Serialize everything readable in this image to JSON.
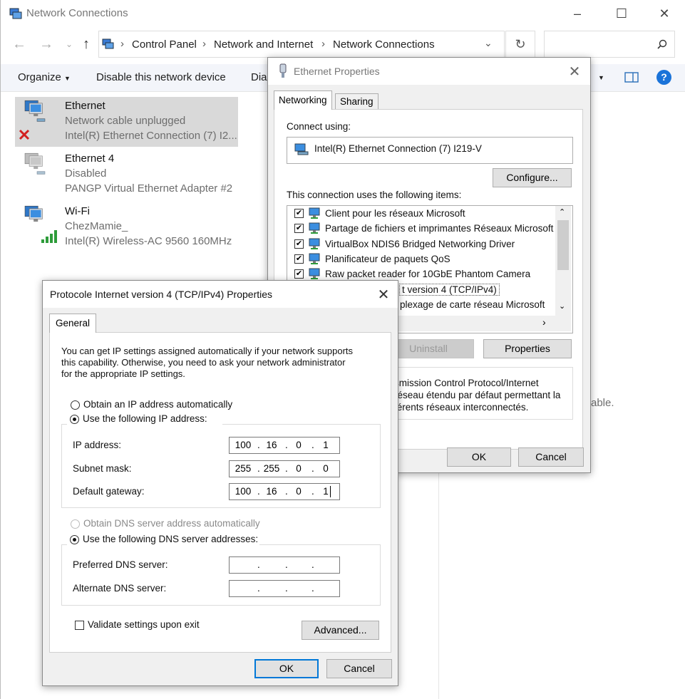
{
  "explorer": {
    "title": "Network Connections",
    "breadcrumb": [
      "Control Panel",
      "Network and Internet",
      "Network Connections"
    ],
    "toolbar": {
      "organize": "Organize",
      "disable": "Disable this network device",
      "diagnose_partial": "Diag"
    },
    "side_partial_text": "able.",
    "adapters": [
      {
        "name": "Ethernet",
        "status": "Network cable unplugged",
        "device": "Intel(R) Ethernet Connection (7) I2..."
      },
      {
        "name": "Ethernet 4",
        "status": "Disabled",
        "device": "PANGP Virtual Ethernet Adapter #2"
      },
      {
        "name": "Wi-Fi",
        "status": "ChezMamie_",
        "device": "Intel(R) Wireless-AC 9560 160MHz"
      }
    ]
  },
  "eth_props": {
    "title": "Ethernet Properties",
    "tabs": [
      "Networking",
      "Sharing"
    ],
    "connect_using_label": "Connect using:",
    "adapter_name": "Intel(R) Ethernet Connection (7) I219-V",
    "configure_label": "Configure...",
    "items_label": "This connection uses the following items:",
    "items": [
      {
        "label": "Client pour les réseaux Microsoft",
        "checked": true
      },
      {
        "label": "Partage de fichiers et imprimantes Réseaux Microsoft",
        "checked": true
      },
      {
        "label": "VirtualBox NDIS6 Bridged Networking Driver",
        "checked": true
      },
      {
        "label": "Planificateur de paquets QoS",
        "checked": true
      },
      {
        "label": "Raw packet reader for 10GbE Phantom Camera",
        "checked": true
      },
      {
        "label": "t version 4 (TCP/IPv4)",
        "checked": true
      },
      {
        "label": "plexage de carte réseau Microsoft",
        "checked": false
      }
    ],
    "uninstall_label": "Uninstall",
    "properties_label": "Properties",
    "description": [
      "smission Control Protocol/Internet",
      "réseau étendu par défaut permettant la",
      "férents réseaux interconnectés."
    ],
    "ok_label": "OK",
    "cancel_label": "Cancel"
  },
  "ipv4": {
    "title": "Protocole Internet version 4 (TCP/IPv4) Properties",
    "tab": "General",
    "intro": [
      "You can get IP settings assigned automatically if your network supports",
      "this capability. Otherwise, you need to ask your network administrator",
      "for the appropriate IP settings."
    ],
    "radio_auto_ip": "Obtain an IP address automatically",
    "radio_manual_ip": "Use the following IP address:",
    "ip_label": "IP address:",
    "ip": [
      "100",
      "16",
      "0",
      "1"
    ],
    "mask_label": "Subnet mask:",
    "mask": [
      "255",
      "255",
      "0",
      "0"
    ],
    "gateway_label": "Default gateway:",
    "gateway": [
      "100",
      "16",
      "0",
      "1"
    ],
    "radio_auto_dns": "Obtain DNS server address automatically",
    "radio_manual_dns": "Use the following DNS server addresses:",
    "pref_dns_label": "Preferred DNS server:",
    "alt_dns_label": "Alternate DNS server:",
    "validate_label": "Validate settings upon exit",
    "advanced_label": "Advanced...",
    "ok_label": "OK",
    "cancel_label": "Cancel"
  }
}
